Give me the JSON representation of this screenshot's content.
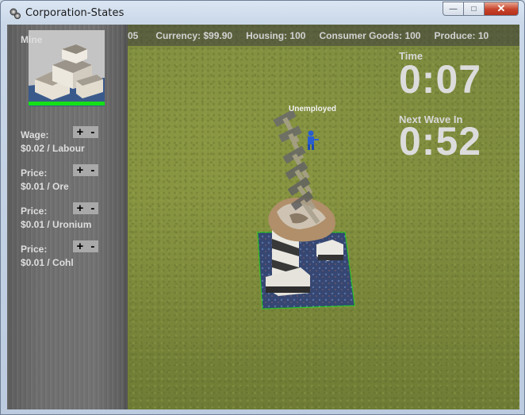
{
  "window": {
    "title": "Corporation-States",
    "minimize_glyph": "—",
    "maximize_glyph": "□",
    "close_glyph": "✕"
  },
  "hud": {
    "items": [
      "05",
      "Currency: $99.90",
      "Housing: 100",
      "Consumer Goods: 100",
      "Produce: 10"
    ]
  },
  "selection": {
    "name": "Mine",
    "health_fraction": 1.0,
    "health_color": "#15e017",
    "stats": [
      {
        "label": "Wage:",
        "value": "$0.02 / Labour"
      },
      {
        "label": "Price:",
        "value": "$0.01 / Ore"
      },
      {
        "label": "Price:",
        "value": "$0.01 / Uronium"
      },
      {
        "label": "Price:",
        "value": "$0.01 / Cohl"
      }
    ],
    "plus_glyph": "+",
    "minus_glyph": "-"
  },
  "timers": {
    "time_label": "Time",
    "time_value": "0:07",
    "wave_label": "Next Wave In",
    "wave_value": "0:52"
  },
  "unit": {
    "status": "Unemployed",
    "color": "#2a5fd0"
  },
  "icons": {
    "app": "cog-chain-icon",
    "building": "mine-building-icon",
    "unit": "worker-icon",
    "resource": "ore-rock-icon"
  }
}
